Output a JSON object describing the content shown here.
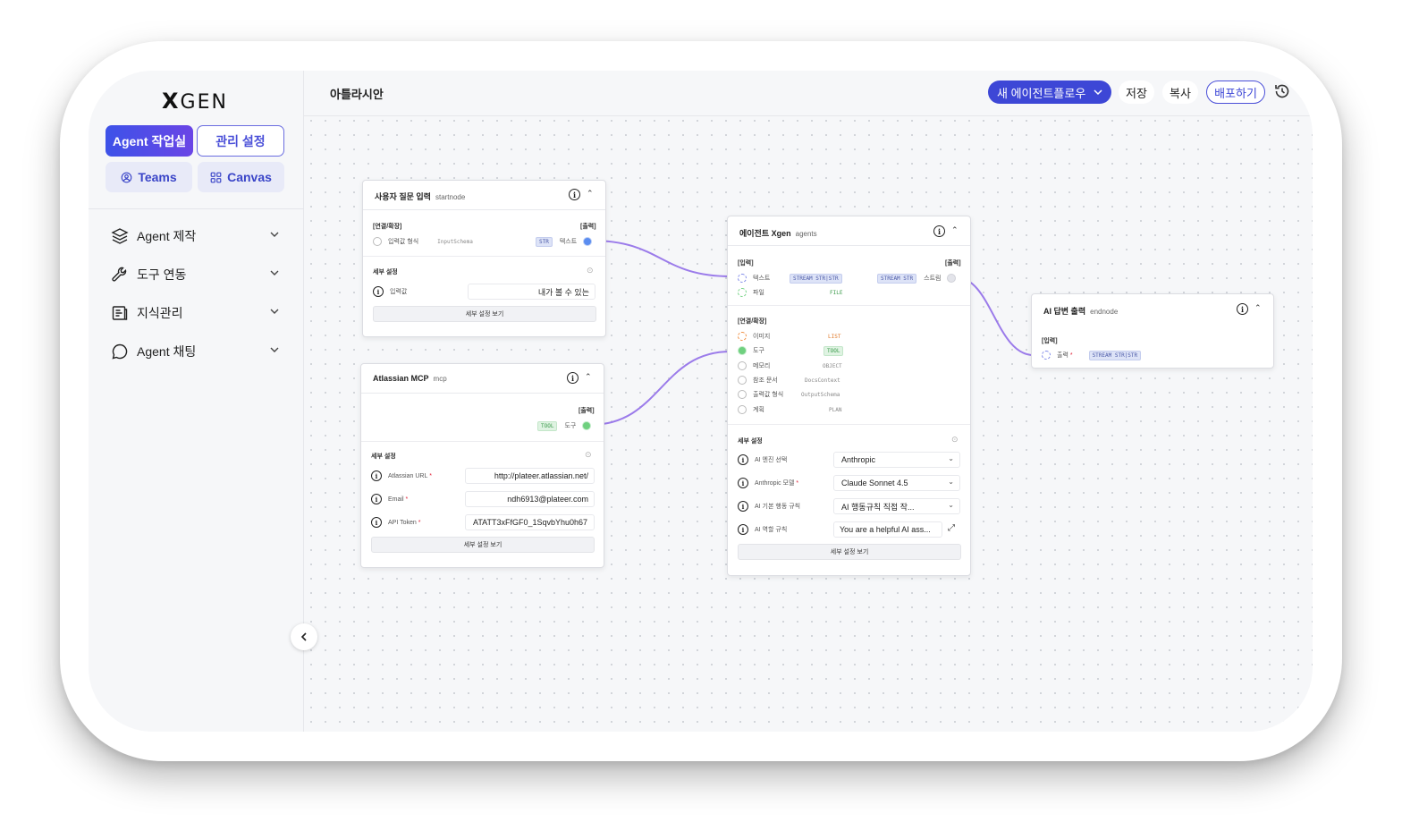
{
  "app": {
    "logo": "XGEN",
    "workspace_title": "아틀라시안"
  },
  "sidebar": {
    "primary_tab": "Agent 작업실",
    "secondary_tab": "관리 설정",
    "teams_label": "Teams",
    "canvas_label": "Canvas",
    "menu": [
      {
        "label": "Agent 제작",
        "icon": "layers-icon"
      },
      {
        "label": "도구 연동",
        "icon": "wrench-icon"
      },
      {
        "label": "지식관리",
        "icon": "document-icon"
      },
      {
        "label": "Agent 채팅",
        "icon": "chat-icon"
      }
    ]
  },
  "toolbar": {
    "workflow_select": "새 에이전트플로우",
    "save": "저장",
    "copy": "복사",
    "deploy": "배포하기"
  },
  "nodes": {
    "start": {
      "title": "사용자 질문 입력",
      "type": "startnode",
      "section_connect": "[연결/확장]",
      "section_output": "[출력]",
      "port_in_label": "입력값 형식",
      "port_in_type": "InputSchema",
      "port_out_tag": "STR",
      "port_out_label": "텍스트",
      "detail_title": "세부 설정",
      "field_label": "입력값",
      "field_value": "내가 볼 수 있는",
      "detail_button": "세부 설정 보기"
    },
    "mcp": {
      "title": "Atlassian MCP",
      "type": "mcp",
      "section_output": "[출력]",
      "port_out_tag": "TOOL",
      "port_out_label": "도구",
      "detail_title": "세부 설정",
      "fields": [
        {
          "label": "Atlassian URL",
          "value": "http://plateer.atlassian.net/"
        },
        {
          "label": "Email",
          "value": "ndh6913@plateer.com"
        },
        {
          "label": "API Token",
          "value": "ATATT3xFfGF0_1SqvbYhu0h67"
        }
      ],
      "detail_button": "세부 설정 보기"
    },
    "agent": {
      "title": "에이전트 Xgen",
      "type": "agents",
      "section_input": "[입력]",
      "section_output": "[출력]",
      "inputs": [
        {
          "label": "텍스트",
          "tag": "STREAM STR|STR"
        },
        {
          "label": "파일",
          "tag": "FILE"
        }
      ],
      "output": {
        "tag": "STREAM STR",
        "label": "스트림"
      },
      "section_connect": "[연결/확장]",
      "connects": [
        {
          "label": "이미지",
          "tag": "LIST"
        },
        {
          "label": "도구",
          "tag": "TOOL"
        },
        {
          "label": "메모리",
          "tag": "OBJECT"
        },
        {
          "label": "참조 문서",
          "tag": "DocsContext"
        },
        {
          "label": "출력값 형식",
          "tag": "OutputSchema"
        },
        {
          "label": "계획",
          "tag": "PLAN"
        }
      ],
      "detail_title": "세부 설정",
      "fields": [
        {
          "label": "AI 엔진 선택",
          "value": "Anthropic"
        },
        {
          "label": "Anthropic 모델",
          "value": "Claude Sonnet 4.5"
        },
        {
          "label": "AI 기본 행동 규칙",
          "value": "AI 행동규칙 직접 작..."
        },
        {
          "label": "AI 역할 규칙",
          "value": "You are a helpful AI ass..."
        }
      ],
      "detail_button": "세부 설정 보기"
    },
    "end": {
      "title": "AI 답변 출력",
      "type": "endnode",
      "section_input": "[입력]",
      "port_in_label": "출력",
      "port_in_tag": "STREAM STR|STR"
    }
  },
  "colors": {
    "accent": "#3d47d6",
    "edge": "#9b7bea",
    "port_blue": "#5b8df0",
    "port_green": "#6fd07f"
  }
}
